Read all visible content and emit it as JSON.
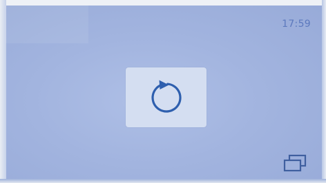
{
  "status_bar": {
    "time": "17:59"
  },
  "icons": {
    "center": "refresh-icon",
    "bottom_right": "windows-icon"
  },
  "colors": {
    "background": "#a2b4df",
    "tile": "#d4def1",
    "accent": "#2e5fae",
    "clock_text": "#5c79be",
    "windows_icon": "#3f5f9f"
  }
}
